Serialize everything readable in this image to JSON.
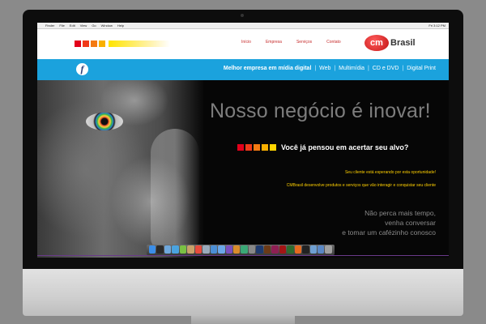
{
  "menubar": {
    "items": [
      "Finder",
      "File",
      "Edit",
      "View",
      "Go",
      "Window",
      "Help"
    ],
    "clock": "Fri 3:12 PM"
  },
  "header": {
    "nav": [
      "Início",
      "Empresa",
      "Serviços",
      "Contato"
    ],
    "logo": {
      "mark": "cm",
      "word": "Brasil"
    },
    "square_colors": [
      "#e3001b",
      "#f03a1a",
      "#f47a12",
      "#f9b000"
    ]
  },
  "band": {
    "tagline_strong": "Melhor empresa em mídia digital",
    "services": [
      "Web",
      "Multimídia",
      "CD e DVD",
      "Digital Print"
    ],
    "separator": "|"
  },
  "hero": {
    "headline": "Nosso negócio é inovar!",
    "question": "Você já pensou em acertar seu alvo?",
    "question_square_colors": [
      "#e3001b",
      "#f03a1a",
      "#f47a12",
      "#f9b000",
      "#ffd400"
    ],
    "body1": "Seu cliente está esperando por esta oportunidade!",
    "body2": "CMBrasil desenvolve produtos e serviços que vão interagir e conquistar seu cliente",
    "cta": [
      "Não perca mais tempo,",
      "venha conversar",
      "e tomar um cafézinho conosco"
    ]
  },
  "dock": {
    "icons": [
      "finder-icon",
      "dashboard-icon",
      "mail-icon",
      "safari-icon",
      "ichat-icon",
      "address-book-icon",
      "ical-icon",
      "preview-icon",
      "itunes-icon",
      "iphoto-icon",
      "imovie-icon",
      "garageband-icon",
      "time-machine-icon",
      "system-preferences-icon",
      "photoshop-icon",
      "illustrator-icon",
      "indesign-icon",
      "flash-icon",
      "dreamweaver-icon",
      "firefox-icon",
      "terminal-icon",
      "folder-icon",
      "downloads-icon",
      "trash-icon"
    ],
    "colors": [
      "#3b8ee8",
      "#2a2a2a",
      "#6fa8dc",
      "#4aa3df",
      "#7ac143",
      "#c8a26a",
      "#e84b3c",
      "#9ab",
      "#4b8fd6",
      "#6aa6e8",
      "#7a4fbf",
      "#d98c2b",
      "#3aa876",
      "#888",
      "#1e3a6e",
      "#6b3a17",
      "#8e1f53",
      "#a31515",
      "#2e6b2e",
      "#e66a1f",
      "#222",
      "#6e9fd2",
      "#5a87c5",
      "#a0a0a0"
    ]
  }
}
